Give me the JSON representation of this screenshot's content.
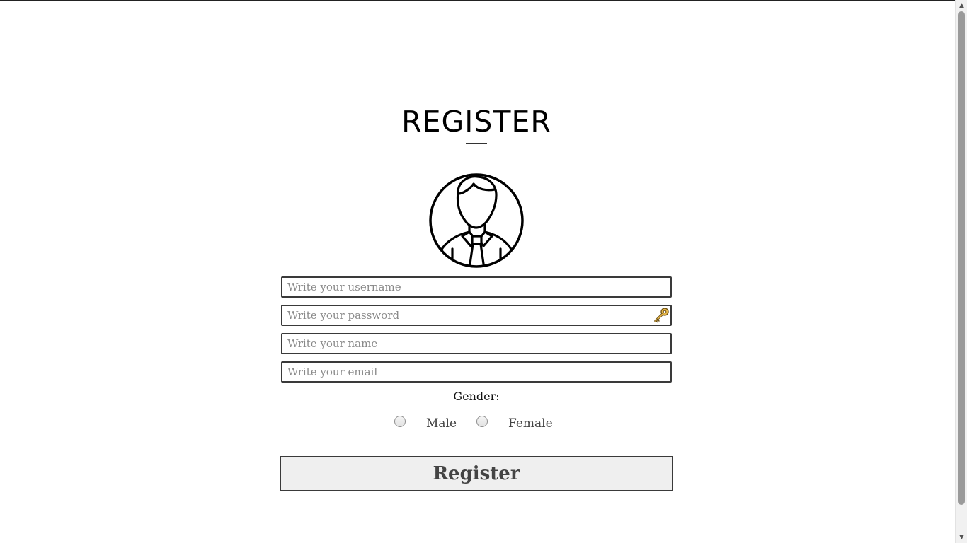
{
  "page": {
    "title": "REGISTER"
  },
  "form": {
    "username_placeholder": "Write your username",
    "password_placeholder": "Write your password",
    "name_placeholder": "Write your name",
    "email_placeholder": "Write your email",
    "gender_label": "Gender:",
    "gender_options": [
      "Male",
      "Female"
    ],
    "submit_label": "Register"
  },
  "icons": {
    "avatar": "user-avatar-icon",
    "password_key": "key-icon"
  },
  "colors": {
    "border": "#3a3a3a",
    "button_bg": "#efefef",
    "button_text": "#444444",
    "key_gold": "#d9a934"
  }
}
